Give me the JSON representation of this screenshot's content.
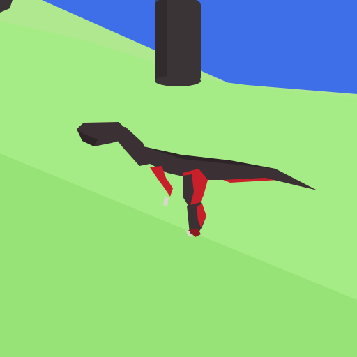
{
  "scene": {
    "type": "low-poly 3D game viewport",
    "colors": {
      "sky": "#3f6fe8",
      "grass_light": "#a6ec86",
      "grass_mid": "#98e378",
      "grass_far": "#b0e88f",
      "trunk": "#3a3436",
      "trunk_shade": "#2a2527",
      "dino_dark": "#3b3034",
      "dino_darker": "#2c2427",
      "dino_red": "#c8202a",
      "dino_red_dark": "#8c1820",
      "claw": "#d8d8c8"
    },
    "objects": [
      "tree-trunk",
      "tree-trunk-corner",
      "dinosaur"
    ]
  }
}
